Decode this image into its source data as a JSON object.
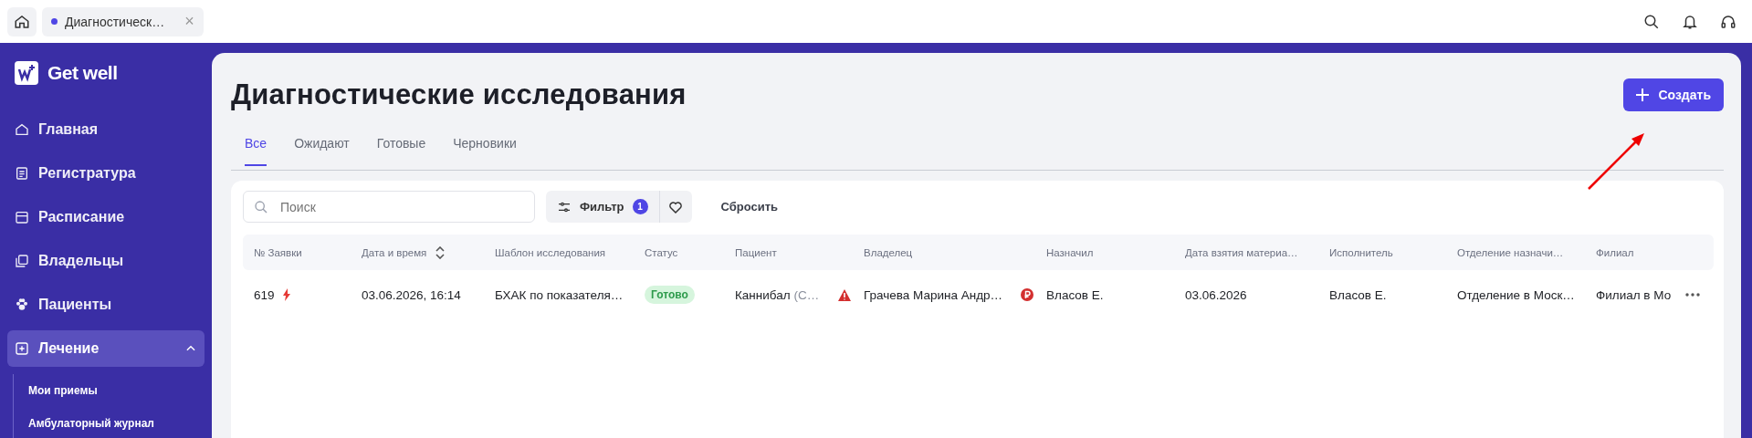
{
  "topbar": {
    "tabs": [
      {
        "label": "Диагностическ…",
        "close": "×",
        "selected": true
      }
    ]
  },
  "sidebar": {
    "logo": "Get well",
    "items": [
      {
        "label": "Главная",
        "expanded": false
      },
      {
        "label": "Регистратура",
        "expanded": false
      },
      {
        "label": "Расписание",
        "expanded": false
      },
      {
        "label": "Владельцы",
        "expanded": false
      },
      {
        "label": "Пациенты",
        "expanded": false
      },
      {
        "label": "Лечение",
        "expanded": true,
        "children": [
          {
            "label": "Мои приемы"
          },
          {
            "label": "Амбулаторный журнал"
          }
        ]
      }
    ]
  },
  "page": {
    "title": "Диагностические исследования",
    "create_button": "Создать",
    "tabs": [
      {
        "label": "Все",
        "selected": true
      },
      {
        "label": "Ожидают",
        "selected": false
      },
      {
        "label": "Готовые",
        "selected": false
      },
      {
        "label": "Черновики",
        "selected": false
      }
    ]
  },
  "toolbar": {
    "search": {
      "placeholder": "Поиск"
    },
    "filter": {
      "label": "Фильтр",
      "count": "1"
    },
    "reset": "Сбросить"
  },
  "table": {
    "columns": [
      {
        "label": "№ Заявки",
        "sortable": false
      },
      {
        "label": "Дата и время",
        "sortable": true
      },
      {
        "label": "Шаблон исследования",
        "sortable": false
      },
      {
        "label": "Статус",
        "sortable": false
      },
      {
        "label": "Пациент",
        "sortable": false
      },
      {
        "label": "Владелец",
        "sortable": false
      },
      {
        "label": "Назначил",
        "sortable": false
      },
      {
        "label": "Дата взятия материа…",
        "sortable": false
      },
      {
        "label": "Исполнитель",
        "sortable": false
      },
      {
        "label": "Отделение назначи…",
        "sortable": false
      },
      {
        "label": "Филиал",
        "sortable": false
      }
    ],
    "rows": [
      {
        "number": "619",
        "urgent": true,
        "datetime": "03.06.2026, 16:14",
        "template": "БХАК по показателя…",
        "status": "Готово",
        "patient": "Каннибал",
        "patient_extra": "(С…",
        "patient_warning": true,
        "owner": "Грачева Марина Андр…",
        "owner_debt": true,
        "assigned_by": "Власов Е.",
        "sample_date": "03.06.2026",
        "performer": "Власов Е.",
        "department": "Отделение в Моск…",
        "branch": "Филиал в Мо"
      }
    ]
  }
}
